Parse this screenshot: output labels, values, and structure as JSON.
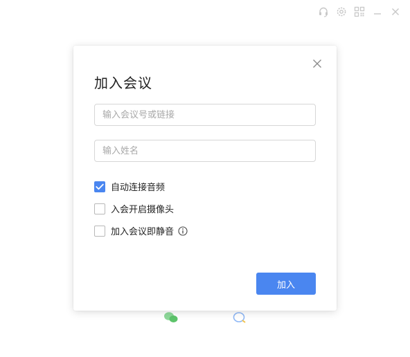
{
  "window_controls": {
    "icons": [
      "headset-icon",
      "settings-icon",
      "qr-code-icon",
      "minimize-icon",
      "close-icon"
    ]
  },
  "dialog": {
    "title": "加入会议",
    "meeting_input": {
      "value": "",
      "placeholder": "输入会议号或链接"
    },
    "name_input": {
      "value": "",
      "placeholder": "输入姓名"
    },
    "options": [
      {
        "label": "自动连接音频",
        "checked": true
      },
      {
        "label": "入会开启摄像头",
        "checked": false
      },
      {
        "label": "加入会议即静音",
        "checked": false,
        "has_info_icon": true
      }
    ],
    "join_label": "加入"
  },
  "colors": {
    "accent": "#4a86f0",
    "title_text": "#222222",
    "placeholder": "#a8a8a8",
    "border": "#d6d6d6",
    "control_icon": "#c8c8c8",
    "wechat_green": "#5cc36a"
  }
}
